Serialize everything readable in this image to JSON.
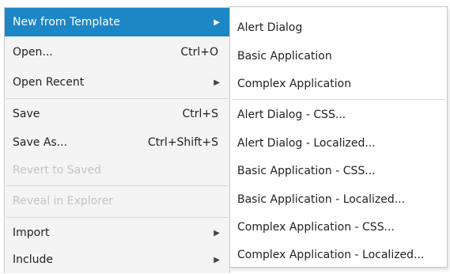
{
  "file_menu": {
    "items": [
      {
        "label": "New from Template",
        "shortcut": "",
        "submenu_arrow": "▶"
      },
      {
        "label": "Open...",
        "shortcut": "Ctrl+O"
      },
      {
        "label": "Open Recent",
        "submenu_arrow": "▶"
      },
      {
        "label": "Save",
        "shortcut": "Ctrl+S"
      },
      {
        "label": "Save As...",
        "shortcut": "Ctrl+Shift+S"
      },
      {
        "label": "Revert to Saved",
        "state": "disabled"
      },
      {
        "label": "Reveal in Explorer",
        "state": "disabled"
      },
      {
        "label": "Import",
        "submenu_arrow": "▶"
      },
      {
        "label": "Include",
        "submenu_arrow": "▶"
      }
    ],
    "highlight_color": "#1d86c5"
  },
  "template_submenu": {
    "items": [
      {
        "label": "Alert Dialog"
      },
      {
        "label": "Basic Application"
      },
      {
        "label": "Complex Application"
      },
      {
        "label": "Alert Dialog - CSS..."
      },
      {
        "label": "Alert Dialog - Localized..."
      },
      {
        "label": "Basic Application - CSS..."
      },
      {
        "label": "Basic Application - Localized..."
      },
      {
        "label": "Complex Application - CSS..."
      },
      {
        "label": "Complex Application - Localized..."
      }
    ]
  }
}
